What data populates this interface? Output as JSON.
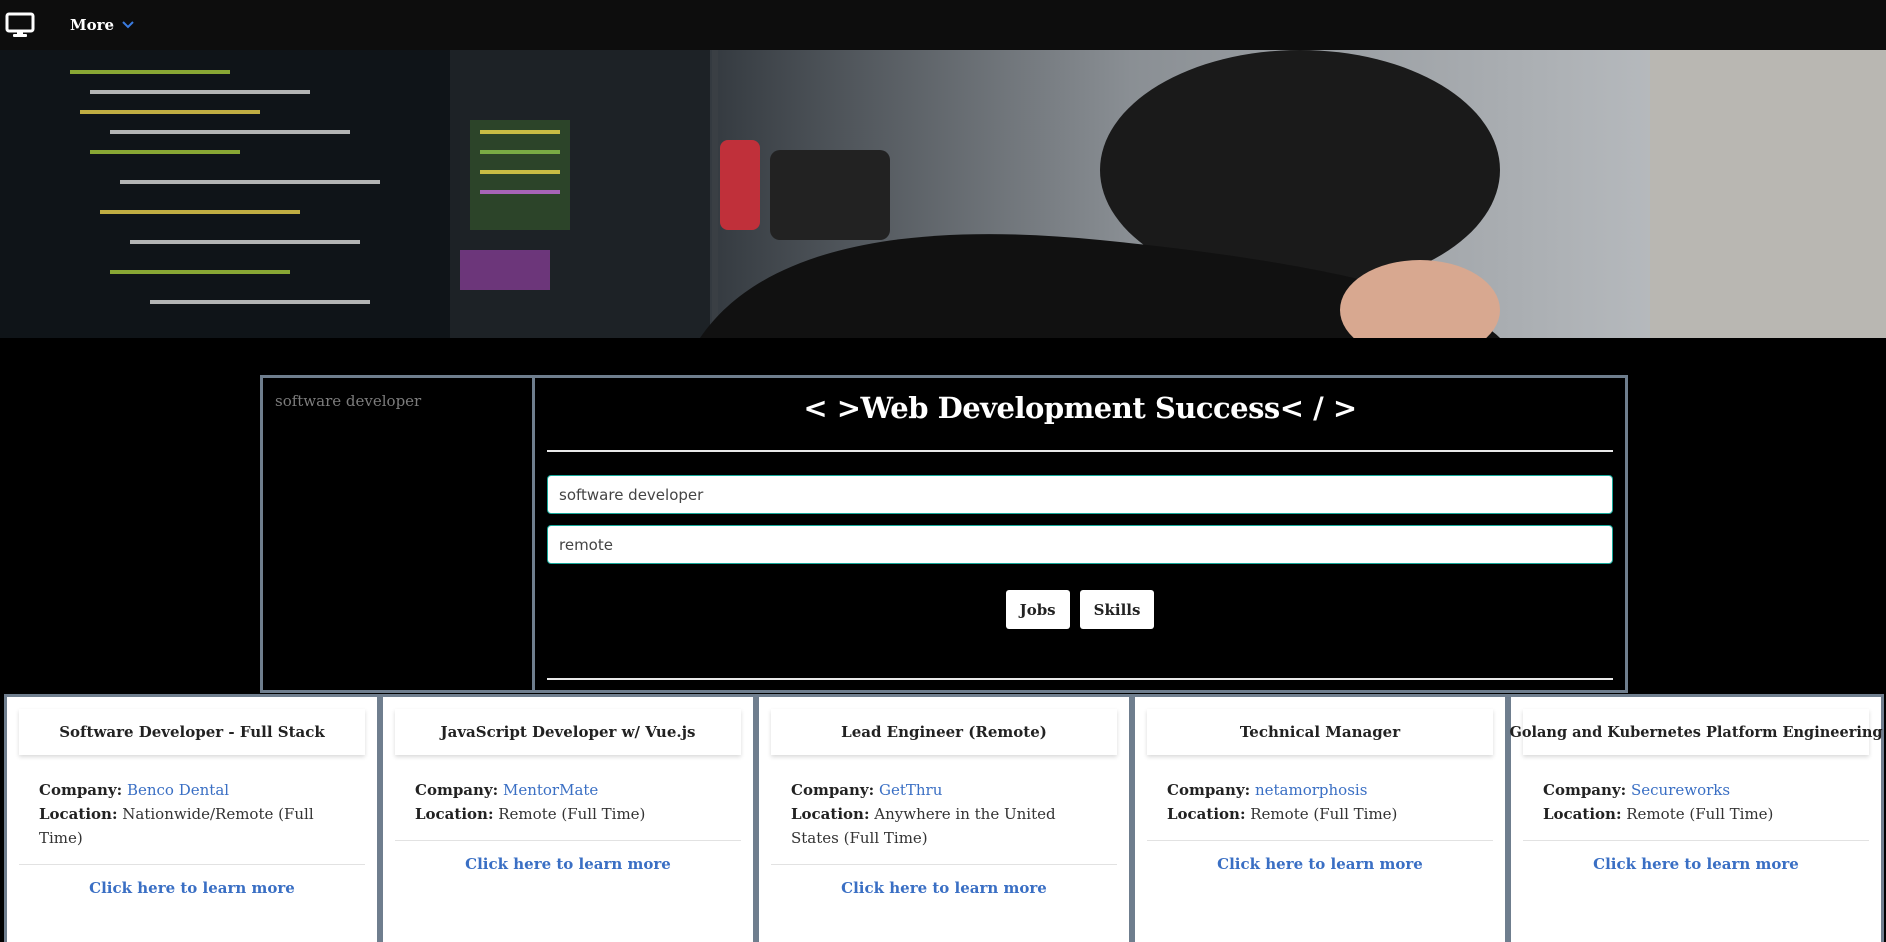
{
  "navbar": {
    "logo_icon": "monitor-icon",
    "more_label": "More",
    "more_icon": "chevron-down-icon"
  },
  "search_panel": {
    "history": [
      "software developer"
    ],
    "title": "< >Web Development Success< / >",
    "keyword_value": "software developer",
    "location_value": "remote",
    "jobs_button": "Jobs",
    "skills_button": "Skills"
  },
  "jobs": [
    {
      "title": "Software Developer - Full Stack",
      "company_label": "Company:",
      "company": "Benco Dental",
      "location_label": "Location:",
      "location": "Nationwide/Remote (Full Time)",
      "link_text": "Click here to learn more"
    },
    {
      "title": "JavaScript Developer w/ Vue.js",
      "company_label": "Company:",
      "company": "MentorMate",
      "location_label": "Location:",
      "location": "Remote (Full Time)",
      "link_text": "Click here to learn more"
    },
    {
      "title": "Lead Engineer (Remote)",
      "company_label": "Company:",
      "company": "GetThru",
      "location_label": "Location:",
      "location": "Anywhere in the United States (Full Time)",
      "link_text": "Click here to learn more"
    },
    {
      "title": "Technical Manager",
      "company_label": "Company:",
      "company": "netamorphosis",
      "location_label": "Location:",
      "location": "Remote (Full Time)",
      "link_text": "Click here to learn more"
    },
    {
      "title": "Golang and Kubernetes Platform Engineering",
      "company_label": "Company:",
      "company": "Secureworks",
      "location_label": "Location:",
      "location": "Remote (Full Time)",
      "link_text": "Click here to learn more"
    }
  ],
  "colors": {
    "link": "#3a6fc4",
    "panel_border": "#6f7e8e",
    "input_border": "#17a89a"
  }
}
